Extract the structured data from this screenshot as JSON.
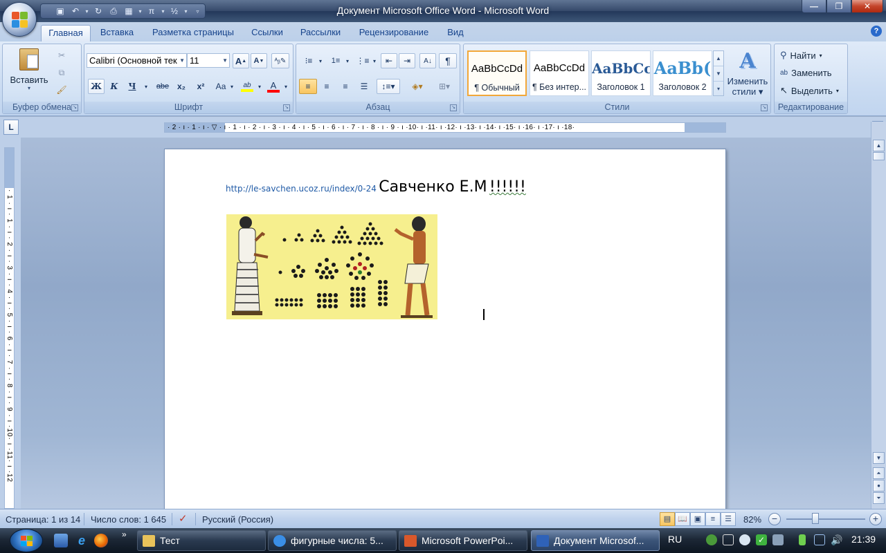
{
  "window": {
    "title": "Документ Microsoft Office Word - Microsoft Word",
    "minimize": "—",
    "maximize": "❐",
    "close": "✕"
  },
  "quick_access": [
    {
      "icon": "save-icon",
      "glyph": "💾"
    },
    {
      "icon": "undo-icon",
      "glyph": "↶"
    },
    {
      "icon": "redo-icon",
      "glyph": "↻"
    },
    {
      "icon": "print-preview-icon",
      "glyph": "🖶"
    },
    {
      "icon": "table-icon",
      "glyph": "▦"
    },
    {
      "icon": "equation-icon",
      "glyph": "π"
    },
    {
      "icon": "numbering-icon",
      "glyph": "½"
    }
  ],
  "tabs": [
    {
      "label": "Главная",
      "active": true
    },
    {
      "label": "Вставка"
    },
    {
      "label": "Разметка страницы"
    },
    {
      "label": "Ссылки"
    },
    {
      "label": "Рассылки"
    },
    {
      "label": "Рецензирование"
    },
    {
      "label": "Вид"
    }
  ],
  "ribbon": {
    "clipboard": {
      "caption": "Буфер обмена",
      "paste_label": "Вставить"
    },
    "font": {
      "caption": "Шрифт",
      "font_name": "Calibri (Основной тек",
      "font_size": "11",
      "bold": "Ж",
      "italic": "К",
      "underline": "Ч",
      "strike": "abe",
      "subscript": "x₂",
      "superscript": "x²",
      "case": "Аа",
      "highlight": "ab",
      "font_color": "A"
    },
    "paragraph": {
      "caption": "Абзац"
    },
    "styles": {
      "caption": "Стили",
      "tiles": [
        {
          "sample": "AaBbCcDd",
          "name": "¶ Обычный",
          "selected": true
        },
        {
          "sample": "AaBbCcDd",
          "name": "¶ Без интер..."
        },
        {
          "sample": "AaBbCc",
          "name": "Заголовок 1"
        },
        {
          "sample": "AaBb(",
          "name": "Заголовок 2"
        }
      ],
      "change_styles_line1": "Изменить",
      "change_styles_line2": "стили"
    },
    "editing": {
      "caption": "Редактирование",
      "find": "Найти",
      "replace": "Заменить",
      "select": "Выделить"
    }
  },
  "ruler": {
    "horizontal": "· 2 · ı · 1 · ı · ▽ · ı · 1 · ı · 2 · ı · 3 · ı · 4 · ı · 5 · ı · 6 · ı · 7 · ı · 8 · ı · 9 · ı ·10· ı ·11· ı ·12· ı ·13· ı ·14· ı ·15· ı ·16· ı ·17· ı ·18·",
    "vertical": "· 1 · ı · 1 · ı · 2 · ı · 3 · ı · 4 · ı · 5 · ı · 6 · ı · 7 · ı · 8 · ı · 9 · ı ·10· ı ·11· ı ·12"
  },
  "document": {
    "link_text": "http://le-savchen.ucoz.ru/index/0-24",
    "heading_text": "Савченко Е.М",
    "heading_tail": "!!!!!!"
  },
  "status": {
    "page": "Страница: 1 из 14",
    "words": "Число слов: 1 645",
    "language": "Русский (Россия)",
    "zoom": "82%"
  },
  "taskbar": {
    "buttons": [
      {
        "label": "Тест",
        "icon": "folder-icon",
        "color": "#e8c25a"
      },
      {
        "label": "фигурные числа: 5...",
        "icon": "ie-icon",
        "color": "#3a8ee6"
      },
      {
        "label": "Microsoft PowerPoi...",
        "icon": "powerpoint-icon",
        "color": "#d9582b"
      },
      {
        "label": "Документ Microsof...",
        "icon": "word-icon",
        "color": "#2f62b8",
        "active": true
      }
    ],
    "language": "RU",
    "clock": "21:39"
  },
  "colors": {
    "accent": "#15428b",
    "highlight_yellow": "#ffff00",
    "font_red": "#ff0000"
  }
}
